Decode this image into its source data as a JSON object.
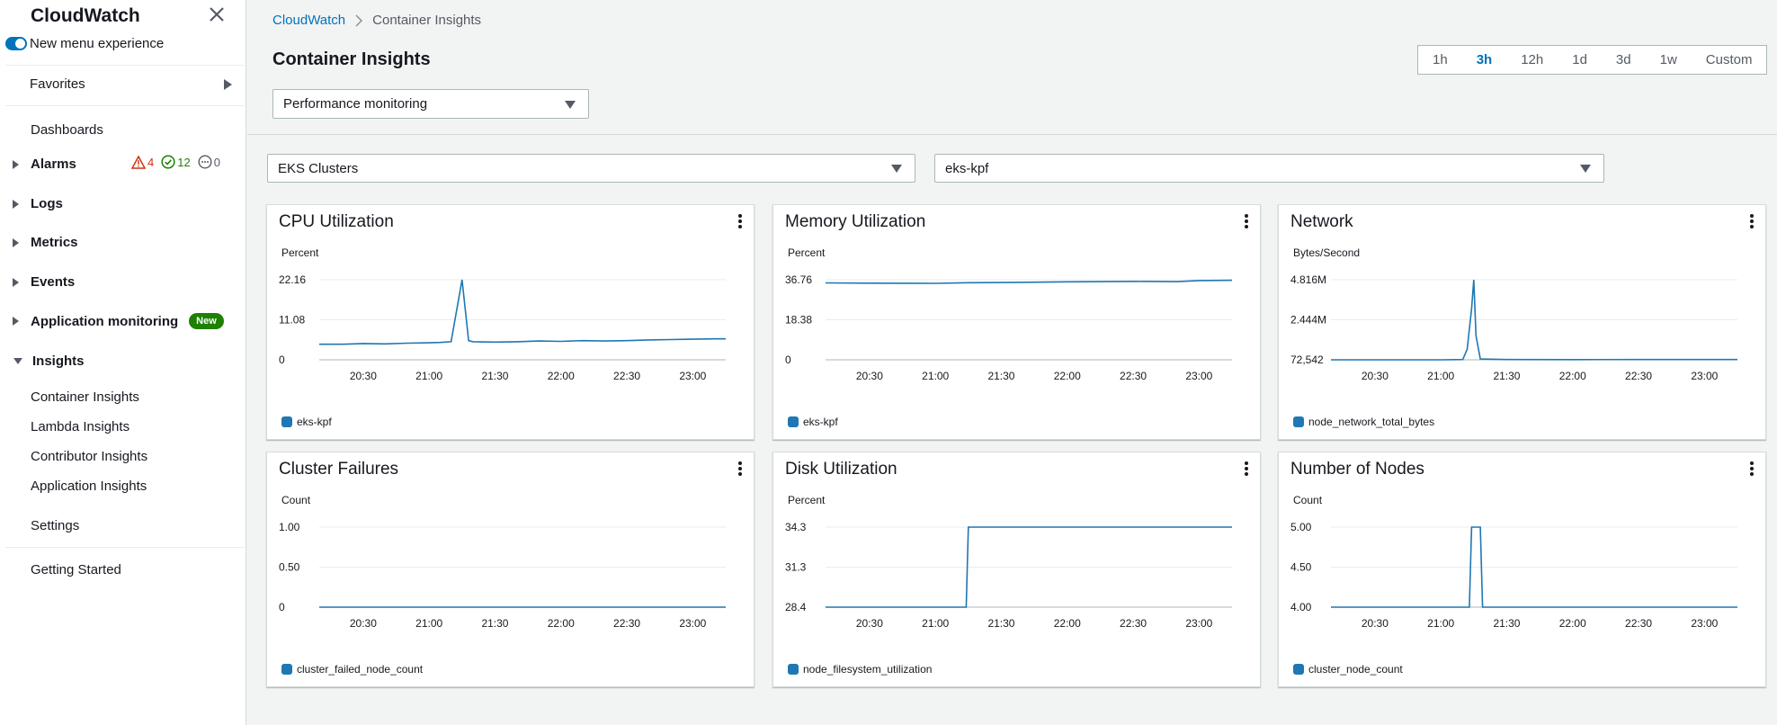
{
  "sidebar": {
    "title": "CloudWatch",
    "new_menu_label": "New menu experience",
    "favorites": "Favorites",
    "dashboards": "Dashboards",
    "alarms": {
      "label": "Alarms",
      "alarm_count": "4",
      "ok_count": "12",
      "insufficient_count": "0"
    },
    "logs": "Logs",
    "metrics": "Metrics",
    "events": "Events",
    "application_monitoring": {
      "label": "Application monitoring",
      "badge": "New"
    },
    "insights": {
      "label": "Insights",
      "items": [
        "Container Insights",
        "Lambda Insights",
        "Contributor Insights",
        "Application Insights"
      ]
    },
    "settings": "Settings",
    "getting_started": "Getting Started"
  },
  "header": {
    "breadcrumb": [
      "CloudWatch",
      "Container Insights"
    ],
    "title": "Container Insights",
    "view_select": "Performance monitoring",
    "time_ranges": [
      "1h",
      "3h",
      "12h",
      "1d",
      "3d",
      "1w",
      "Custom"
    ],
    "active_range": "3h"
  },
  "filters": {
    "resource_type": "EKS Clusters",
    "cluster": "eks-kpf"
  },
  "colors": {
    "accent": "#0073bb",
    "series": "#1f77b4",
    "alarm": "#d13212",
    "ok": "#1d8102",
    "new_badge": "#1d8102"
  },
  "chart_data": [
    {
      "type": "line",
      "title": "CPU Utilization",
      "ylabel": "Percent",
      "yticks": [
        "22.16",
        "11.08",
        "0"
      ],
      "ylim": [
        0,
        22.16
      ],
      "xticks": [
        "20:30",
        "21:00",
        "21:30",
        "22:00",
        "22:30",
        "23:00"
      ],
      "x": [
        "20:10",
        "20:20",
        "20:30",
        "20:40",
        "20:50",
        "21:00",
        "21:05",
        "21:10",
        "21:15",
        "21:18",
        "21:20",
        "21:30",
        "21:40",
        "21:50",
        "22:00",
        "22:10",
        "22:20",
        "22:30",
        "22:40",
        "22:50",
        "23:00",
        "23:10",
        "23:15"
      ],
      "series": [
        {
          "name": "eks-kpf",
          "values": [
            4.3,
            4.3,
            4.5,
            4.4,
            4.6,
            4.7,
            4.8,
            5.0,
            22.16,
            5.3,
            5.0,
            4.9,
            5.0,
            5.2,
            5.1,
            5.3,
            5.2,
            5.3,
            5.5,
            5.6,
            5.7,
            5.8,
            5.8
          ]
        }
      ]
    },
    {
      "type": "line",
      "title": "Memory Utilization",
      "ylabel": "Percent",
      "yticks": [
        "36.76",
        "18.38",
        "0"
      ],
      "ylim": [
        0,
        36.76
      ],
      "xticks": [
        "20:30",
        "21:00",
        "21:30",
        "22:00",
        "22:30",
        "23:00"
      ],
      "x": [
        "20:10",
        "20:30",
        "21:00",
        "21:15",
        "21:30",
        "22:00",
        "22:30",
        "22:50",
        "23:00",
        "23:15"
      ],
      "series": [
        {
          "name": "eks-kpf",
          "values": [
            35.3,
            35.2,
            35.1,
            35.4,
            35.5,
            35.8,
            36.0,
            35.9,
            36.4,
            36.5
          ]
        }
      ]
    },
    {
      "type": "line",
      "title": "Network",
      "ylabel": "Bytes/Second",
      "yticks": [
        "4.816M",
        "2.444M",
        "72,542"
      ],
      "ylim": [
        72542,
        4816000
      ],
      "xticks": [
        "20:30",
        "21:00",
        "21:30",
        "22:00",
        "22:30",
        "23:00"
      ],
      "x": [
        "20:10",
        "20:30",
        "21:00",
        "21:10",
        "21:12",
        "21:14",
        "21:15",
        "21:16",
        "21:18",
        "21:30",
        "22:00",
        "22:30",
        "23:00",
        "23:15"
      ],
      "series": [
        {
          "name": "node_network_total_bytes",
          "values": [
            72542,
            72542,
            72542,
            90000,
            700000,
            3100000,
            4816000,
            1500000,
            120000,
            90000,
            85000,
            90000,
            88000,
            90000
          ]
        }
      ]
    },
    {
      "type": "line",
      "title": "Cluster Failures",
      "ylabel": "Count",
      "yticks": [
        "1.00",
        "0.50",
        "0"
      ],
      "ylim": [
        0,
        1
      ],
      "xticks": [
        "20:30",
        "21:00",
        "21:30",
        "22:00",
        "22:30",
        "23:00"
      ],
      "x": [
        "20:10",
        "23:15"
      ],
      "series": [
        {
          "name": "cluster_failed_node_count",
          "values": [
            0,
            0
          ]
        }
      ]
    },
    {
      "type": "line",
      "title": "Disk Utilization",
      "ylabel": "Percent",
      "yticks": [
        "34.3",
        "31.3",
        "28.4"
      ],
      "ylim": [
        28.4,
        34.3
      ],
      "xticks": [
        "20:30",
        "21:00",
        "21:30",
        "22:00",
        "22:30",
        "23:00"
      ],
      "x": [
        "20:10",
        "21:14",
        "21:15",
        "23:15"
      ],
      "series": [
        {
          "name": "node_filesystem_utilization",
          "values": [
            28.4,
            28.4,
            34.3,
            34.3
          ]
        }
      ]
    },
    {
      "type": "line",
      "title": "Number of Nodes",
      "ylabel": "Count",
      "yticks": [
        "5.00",
        "4.50",
        "4.00"
      ],
      "ylim": [
        4,
        5
      ],
      "xticks": [
        "20:30",
        "21:00",
        "21:30",
        "22:00",
        "22:30",
        "23:00"
      ],
      "x": [
        "20:10",
        "21:13",
        "21:14",
        "21:18",
        "21:19",
        "23:15"
      ],
      "series": [
        {
          "name": "cluster_node_count",
          "values": [
            4,
            4,
            5,
            5,
            4,
            4
          ]
        }
      ]
    }
  ]
}
